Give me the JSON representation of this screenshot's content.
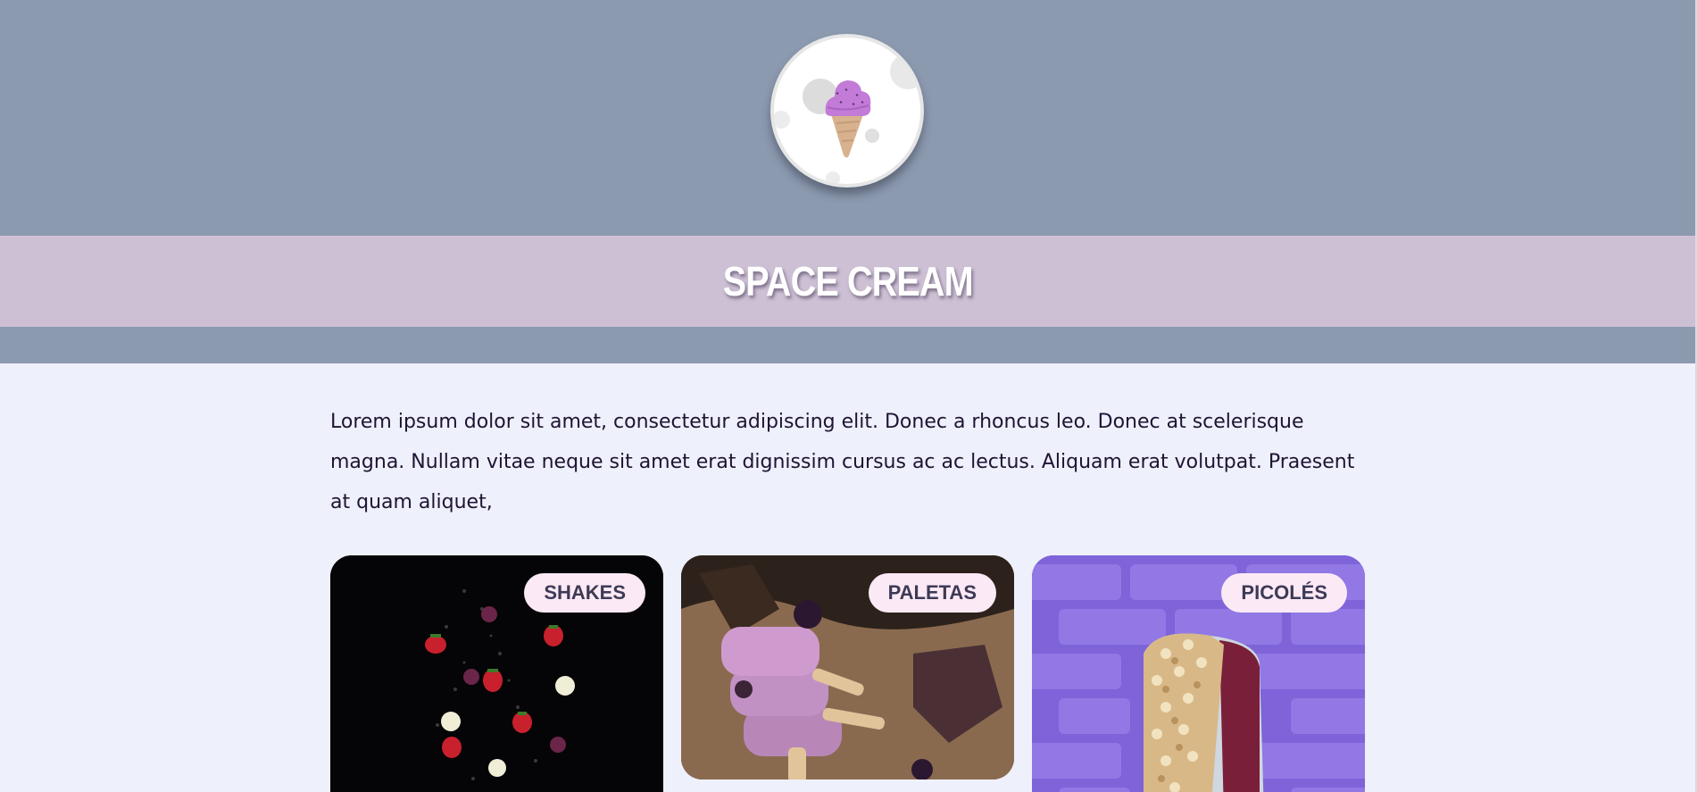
{
  "site": {
    "title": "SPACE CREAM",
    "logo_icon": "ice-cream-cone-icon"
  },
  "intro": {
    "text": "Lorem ipsum dolor sit amet, consectetur adipiscing elit. Donec a rhoncus leo. Donec at scelerisque magna. Nullam vitae neque sit amet erat dignissim cursus ac ac lectus. Aliquam erat volutpat. Praesent at quam aliquet,"
  },
  "cards": [
    {
      "label": "SHAKES",
      "image": "fruits-on-black-photo"
    },
    {
      "label": "PALETAS",
      "image": "stacked-purple-popsicles-photo"
    },
    {
      "label": "PICOLÉS",
      "image": "nut-covered-popsicle-on-purple-bricks-photo"
    }
  ],
  "colors": {
    "header_bg": "#8c9ab0",
    "title_band_bg": "#cdc0d4",
    "page_bg": "#eef0fb",
    "tag_bg": "#fce9f6",
    "tag_text": "#3d3a55",
    "body_text": "#1f1433"
  }
}
